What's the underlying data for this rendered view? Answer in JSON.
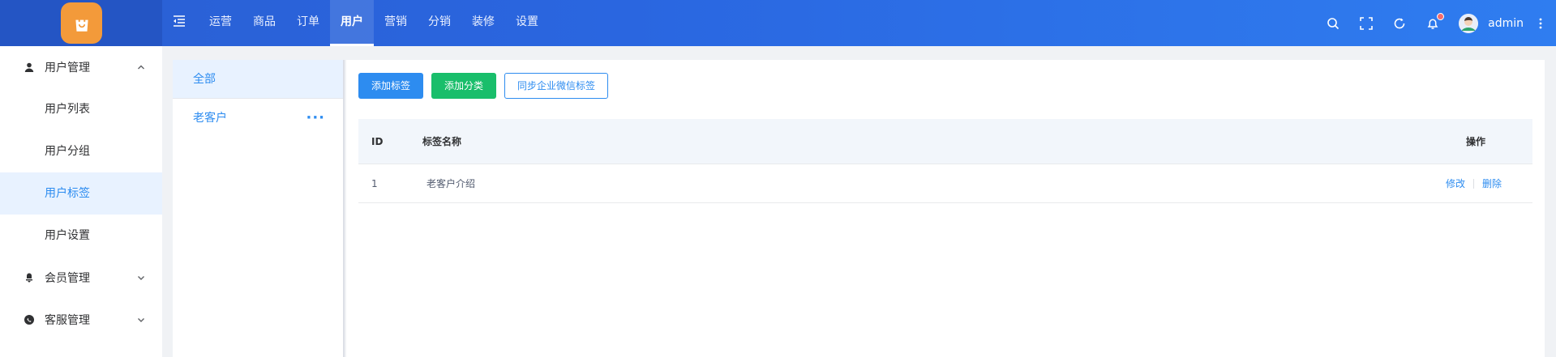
{
  "topbar": {
    "nav": [
      {
        "label": "运营",
        "active": false
      },
      {
        "label": "商品",
        "active": false
      },
      {
        "label": "订单",
        "active": false
      },
      {
        "label": "用户",
        "active": true
      },
      {
        "label": "营销",
        "active": false
      },
      {
        "label": "分销",
        "active": false
      },
      {
        "label": "装修",
        "active": false
      },
      {
        "label": "设置",
        "active": false
      }
    ],
    "username": "admin",
    "icons": [
      "search-icon",
      "fullscreen-icon",
      "refresh-icon",
      "bell-icon",
      "more-vertical-icon"
    ]
  },
  "sidebar": {
    "groups": [
      {
        "label": "用户管理",
        "icon": "user-icon",
        "expanded": true,
        "items": [
          "用户列表",
          "用户分组",
          "用户标签",
          "用户设置"
        ]
      },
      {
        "label": "会员管理",
        "icon": "member-icon",
        "expanded": false
      },
      {
        "label": "客服管理",
        "icon": "chat-icon",
        "expanded": false
      }
    ],
    "active_item": "用户标签"
  },
  "categories": {
    "items": [
      {
        "label": "全部"
      },
      {
        "label": "老客户"
      }
    ],
    "more_glyph": "···"
  },
  "toolbar": {
    "add_tag": "添加标签",
    "add_category": "添加分类",
    "sync_wechat": "同步企业微信标签"
  },
  "table": {
    "columns": {
      "id": "ID",
      "name": "标签名称",
      "op": "操作"
    },
    "rows": [
      {
        "id": "1",
        "name": "老客户介绍",
        "edit": "修改",
        "delete": "删除"
      }
    ]
  },
  "colors": {
    "primary": "#2d8cf0",
    "success": "#19be6b",
    "header_gradient_start": "#2a5fd3",
    "header_gradient_end": "#2f7df0",
    "logo": "#f39a3a",
    "badge": "#f56c6c"
  }
}
